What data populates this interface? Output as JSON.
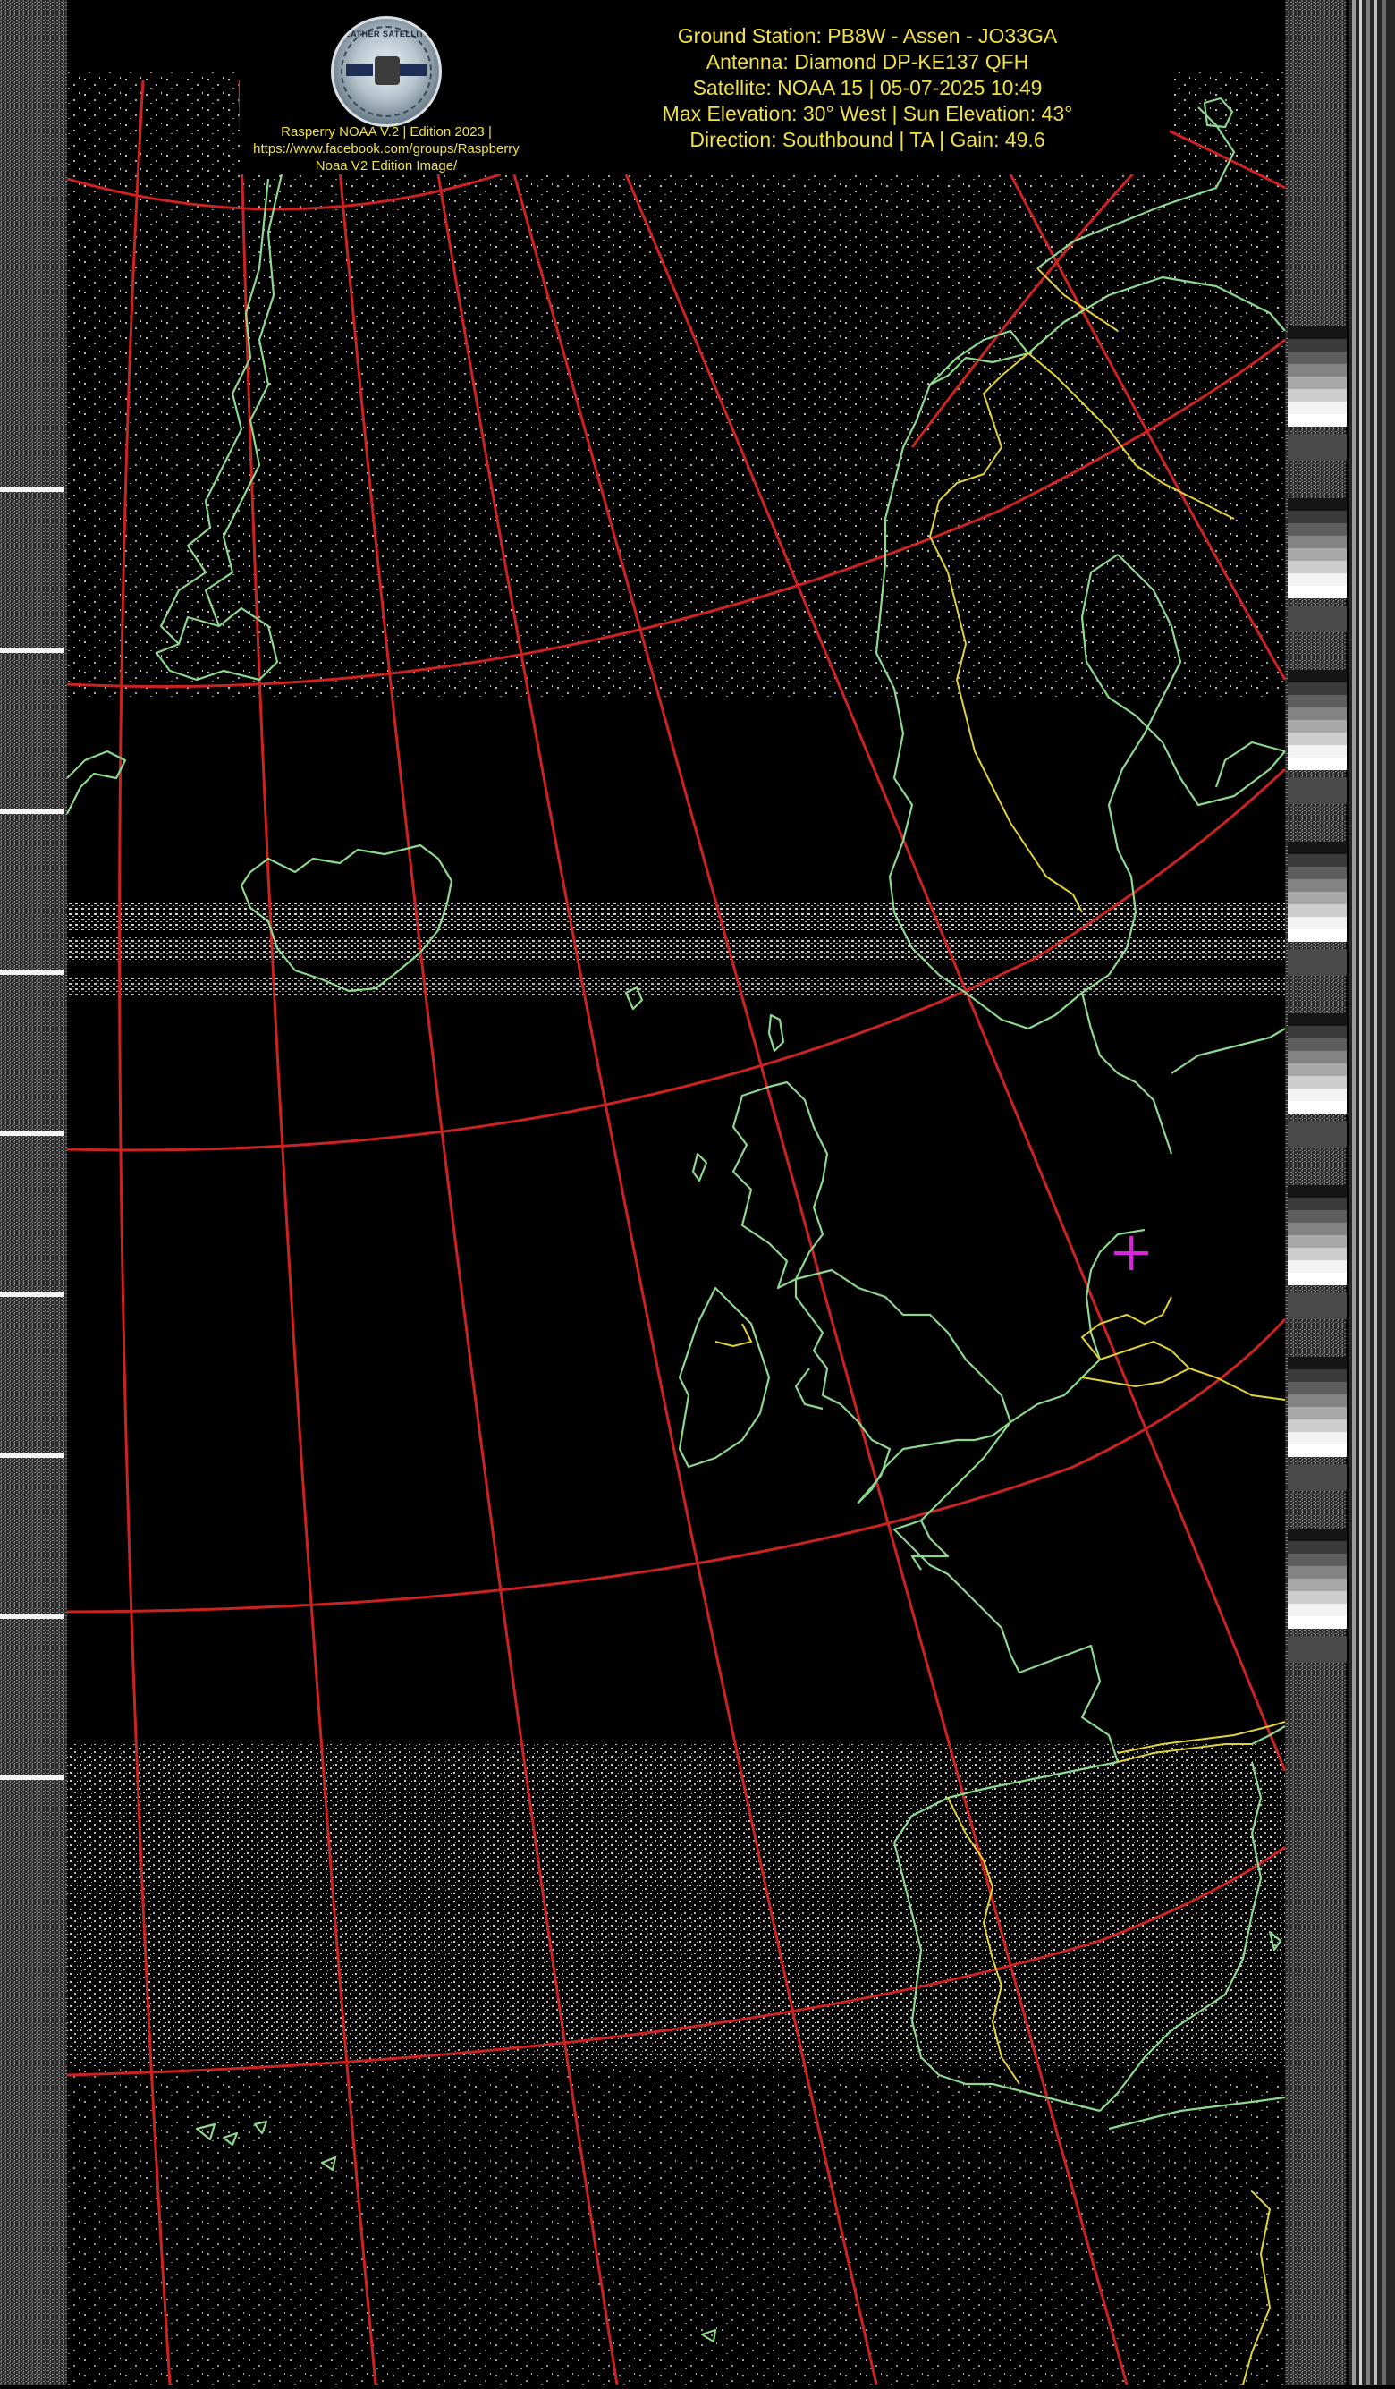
{
  "header": {
    "logo_text": "WEATHER SATELLITES",
    "credit_lines": [
      "Rasperry NOAA V.2 | Edition 2023 |",
      "https://www.facebook.com/groups/Raspberry",
      "Noaa V2 Edition Image/"
    ],
    "info_lines": [
      "Ground Station: PB8W - Assen - JO33GA",
      "Antenna: Diamond DP-KE137 QFH",
      "Satellite: NOAA 15 | 05-07-2025 10:49",
      "Max Elevation: 30° West | Sun Elevation: 43°",
      "Direction: Southbound | TA | Gain: 49.6"
    ]
  },
  "colors": {
    "text": "#f0e04a",
    "graticule": "#cc2222",
    "coastline": "#8ed88e",
    "borders": "#e2d23a",
    "marker": "#e020e0",
    "background": "#000000"
  },
  "icons": {
    "station_marker": "crosshair-icon",
    "logo": "weather-satellites-logo"
  }
}
